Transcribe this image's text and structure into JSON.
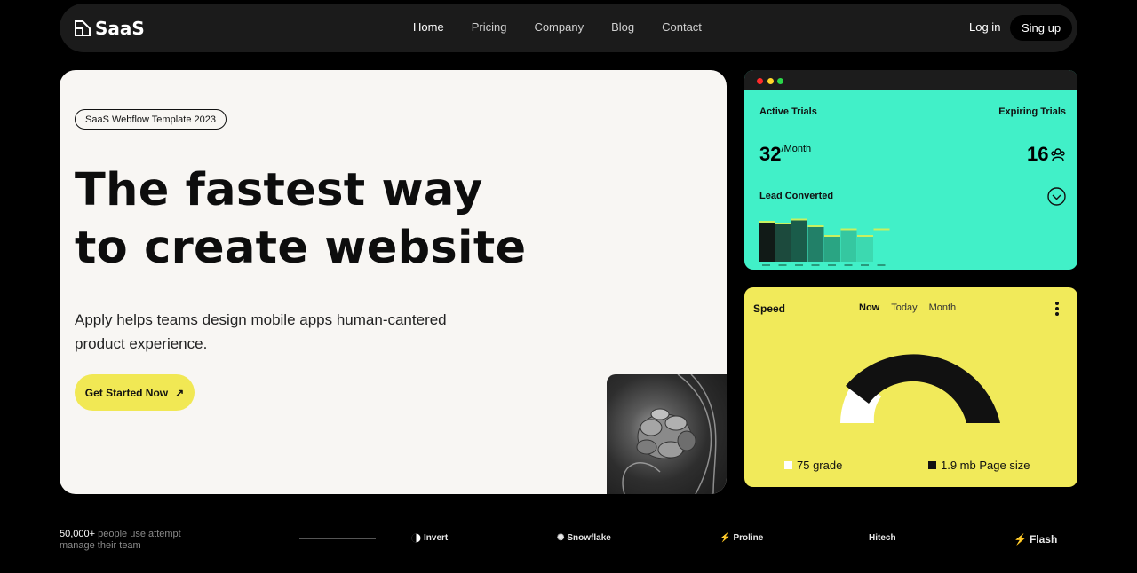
{
  "nav": {
    "logo": "SaaS",
    "links": [
      "Home",
      "Pricing",
      "Company",
      "Blog",
      "Contact"
    ],
    "login": "Log in",
    "signup": "Sing up"
  },
  "hero": {
    "badge": "SaaS Webflow Template 2023",
    "title_line1": "The fastest way",
    "title_line2": "to create website",
    "subtitle": "Apply helps teams design mobile apps human-cantered product experience.",
    "cta": "Get Started Now",
    "cta_icon": "arrow-up-right-icon"
  },
  "trials": {
    "active_label": "Active Trials",
    "active_value": "32",
    "active_unit": "/Month",
    "expiring_label": "Expiring Trials",
    "expiring_value": "16",
    "lead_label": "Lead Converted",
    "bars": [
      0.92,
      0.88,
      0.97,
      0.82,
      0.6,
      0.75,
      0.6,
      0.75
    ],
    "bar_colors": [
      "#111a17",
      "#1c4a3d",
      "#1a5c4a",
      "#228068",
      "#2aa583",
      "#35c7a0",
      "#3cd9b0",
      "#41f0c8"
    ]
  },
  "speed": {
    "label": "Speed",
    "tabs": [
      "Now",
      "Today",
      "Month"
    ],
    "active_tab": "Now",
    "grade_legend": "75 grade",
    "size_legend": "1.9 mb Page size"
  },
  "social_proof": {
    "count": "50,000+",
    "text_rest": " people use attempt",
    "line2": "manage their team",
    "brands": [
      "Invert",
      "Snowflake",
      "Proline",
      "Hitech",
      "Flash"
    ]
  },
  "colors": {
    "accent_yellow": "#f1ea5a",
    "accent_teal": "#41f0c8",
    "hero_bg": "#f8f6f3"
  }
}
